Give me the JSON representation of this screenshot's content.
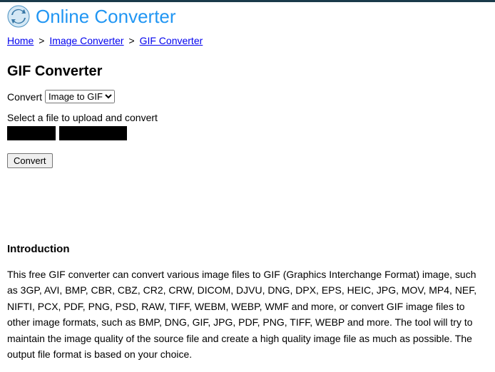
{
  "header": {
    "site_title": "Online Converter"
  },
  "breadcrumb": {
    "home": "Home",
    "sep": ">",
    "level1": "Image Converter",
    "level2": "GIF Converter"
  },
  "main": {
    "page_title": "GIF Converter",
    "convert_label": "Convert",
    "convert_selected": "Image to GIF",
    "select_file_label": "Select a file to upload and convert",
    "convert_button": "Convert"
  },
  "intro": {
    "heading": "Introduction",
    "text": "This free GIF converter can convert various image files to GIF (Graphics Interchange Format) image, such as 3GP, AVI, BMP, CBR, CBZ, CR2, CRW, DICOM, DJVU, DNG, DPX, EPS, HEIC, JPG, MOV, MP4, NEF, NIFTI, PCX, PDF, PNG, PSD, RAW, TIFF, WEBM, WEBP, WMF and more, or convert GIF image files to other image formats, such as BMP, DNG, GIF, JPG, PDF, PNG, TIFF, WEBP and more. The tool will try to maintain the image quality of the source file and create a high quality image file as much as possible. The output file format is based on your choice."
  }
}
